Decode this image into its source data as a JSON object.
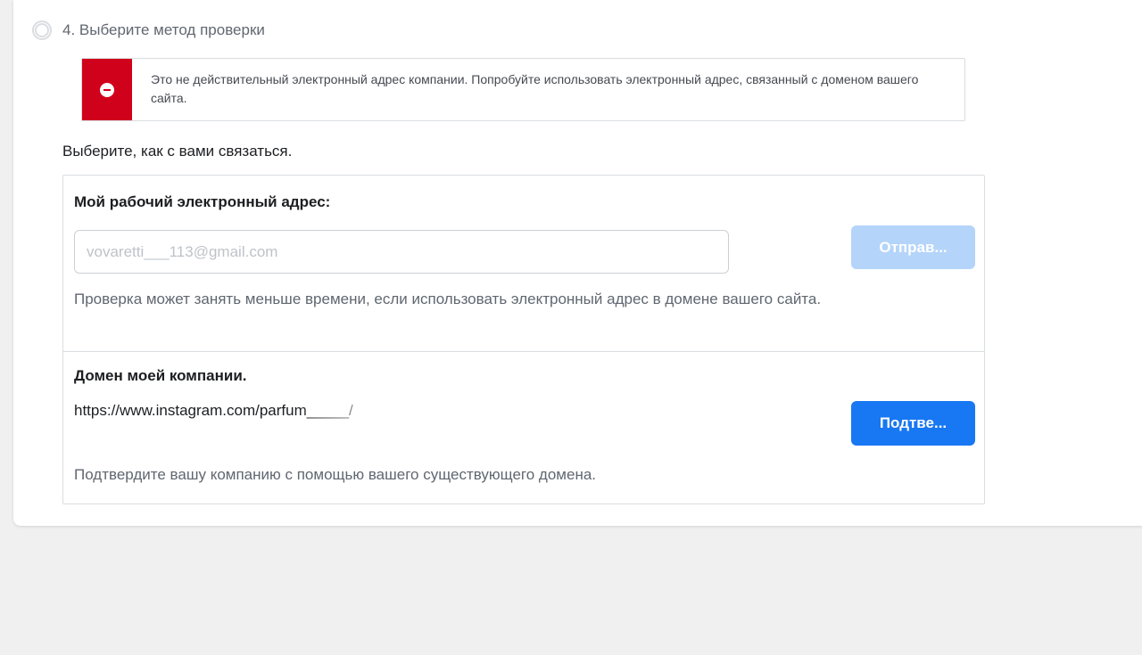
{
  "step": {
    "title": "4. Выберите метод проверки"
  },
  "error": {
    "message": "Это не действительный электронный адрес компании. Попробуйте использовать электронный адрес, связанный с доменом вашего сайта.",
    "color": "#d0021b"
  },
  "contact": {
    "prompt": "Выберите, как с вами связаться."
  },
  "email_option": {
    "title": "Мой рабочий электронный адрес:",
    "input_value": "vovaretti___113@gmail.com",
    "send_label": "Отправ...",
    "hint": "Проверка может занять меньше времени, если использовать электронный адрес в домене вашего сайта."
  },
  "domain_option": {
    "title": "Домен моей компании.",
    "url": "https://www.instagram.com/parfum_____/",
    "confirm_label": "Подтве...",
    "hint": "Подтвердите вашу компанию с помощью вашего существующего домена."
  },
  "colors": {
    "primary_button": "#1877f2",
    "disabled_button": "#b4d4fa"
  }
}
